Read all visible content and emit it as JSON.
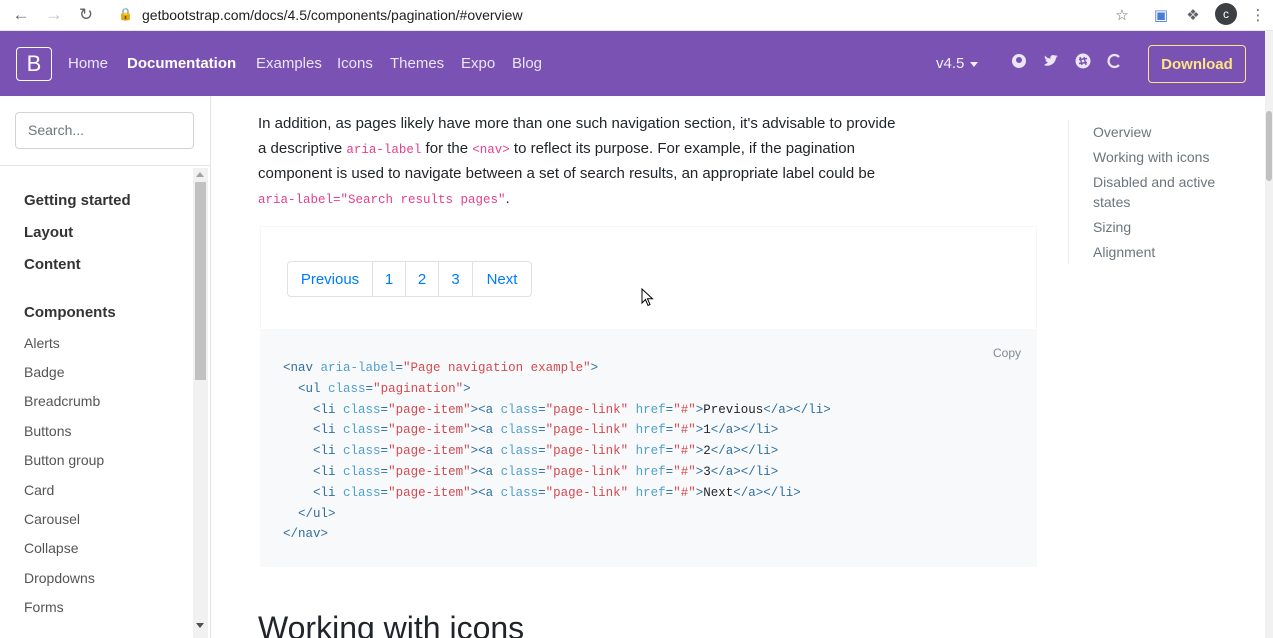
{
  "browser": {
    "url": "getbootstrap.com/docs/4.5/components/pagination/#overview",
    "avatar_letter": "c",
    "icons": [
      "back-icon",
      "forward-icon",
      "reload-icon",
      "lock-icon",
      "star-icon",
      "translate-icon",
      "extensions-icon",
      "menu-dots-icon"
    ]
  },
  "navbar": {
    "brand": "B",
    "links": [
      "Home",
      "Documentation",
      "Examples",
      "Icons",
      "Themes",
      "Expo",
      "Blog"
    ],
    "active": "Documentation",
    "version": "v4.5",
    "download": "Download",
    "accent": "#7952b3"
  },
  "sidebar": {
    "search_placeholder": "Search...",
    "groups": [
      "Getting started",
      "Layout",
      "Content",
      "Components"
    ],
    "items": [
      "Alerts",
      "Badge",
      "Breadcrumb",
      "Buttons",
      "Button group",
      "Card",
      "Carousel",
      "Collapse",
      "Dropdowns",
      "Forms"
    ]
  },
  "content": {
    "para_1": "In addition, as pages likely have more than one such navigation section, it's advisable to provide a descriptive ",
    "code_1": "aria-label",
    "para_2": " for the ",
    "code_2": "<nav>",
    "para_3": " to reflect its purpose. For example, if the pagination component is used to navigate between a set of search results, an appropriate label could be ",
    "code_3": "aria-label=\"Search results pages\"",
    "para_4": ".",
    "pagination": [
      "Previous",
      "1",
      "2",
      "3",
      "Next"
    ],
    "copy": "Copy",
    "code_lines": [
      {
        "indent": "",
        "parts": [
          [
            "tag",
            "<nav "
          ],
          [
            "attr",
            "aria-label"
          ],
          [
            "tag",
            "="
          ],
          [
            "val",
            "\"Page navigation example\""
          ],
          [
            "tag",
            ">"
          ]
        ]
      },
      {
        "indent": "  ",
        "parts": [
          [
            "tag",
            "<ul "
          ],
          [
            "attr",
            "class"
          ],
          [
            "tag",
            "="
          ],
          [
            "val",
            "\"pagination\""
          ],
          [
            "tag",
            ">"
          ]
        ]
      },
      {
        "indent": "    ",
        "parts": [
          [
            "tag",
            "<li "
          ],
          [
            "attr",
            "class"
          ],
          [
            "tag",
            "="
          ],
          [
            "val",
            "\"page-item\""
          ],
          [
            "tag",
            "><a "
          ],
          [
            "attr",
            "class"
          ],
          [
            "tag",
            "="
          ],
          [
            "val",
            "\"page-link\""
          ],
          [
            "tag",
            " "
          ],
          [
            "attr",
            "href"
          ],
          [
            "tag",
            "="
          ],
          [
            "val",
            "\"#\""
          ],
          [
            "tag",
            ">"
          ],
          [
            "text",
            "Previous"
          ],
          [
            "tag",
            "</a></li>"
          ]
        ]
      },
      {
        "indent": "    ",
        "parts": [
          [
            "tag",
            "<li "
          ],
          [
            "attr",
            "class"
          ],
          [
            "tag",
            "="
          ],
          [
            "val",
            "\"page-item\""
          ],
          [
            "tag",
            "><a "
          ],
          [
            "attr",
            "class"
          ],
          [
            "tag",
            "="
          ],
          [
            "val",
            "\"page-link\""
          ],
          [
            "tag",
            " "
          ],
          [
            "attr",
            "href"
          ],
          [
            "tag",
            "="
          ],
          [
            "val",
            "\"#\""
          ],
          [
            "tag",
            ">"
          ],
          [
            "text",
            "1"
          ],
          [
            "tag",
            "</a></li>"
          ]
        ]
      },
      {
        "indent": "    ",
        "parts": [
          [
            "tag",
            "<li "
          ],
          [
            "attr",
            "class"
          ],
          [
            "tag",
            "="
          ],
          [
            "val",
            "\"page-item\""
          ],
          [
            "tag",
            "><a "
          ],
          [
            "attr",
            "class"
          ],
          [
            "tag",
            "="
          ],
          [
            "val",
            "\"page-link\""
          ],
          [
            "tag",
            " "
          ],
          [
            "attr",
            "href"
          ],
          [
            "tag",
            "="
          ],
          [
            "val",
            "\"#\""
          ],
          [
            "tag",
            ">"
          ],
          [
            "text",
            "2"
          ],
          [
            "tag",
            "</a></li>"
          ]
        ]
      },
      {
        "indent": "    ",
        "parts": [
          [
            "tag",
            "<li "
          ],
          [
            "attr",
            "class"
          ],
          [
            "tag",
            "="
          ],
          [
            "val",
            "\"page-item\""
          ],
          [
            "tag",
            "><a "
          ],
          [
            "attr",
            "class"
          ],
          [
            "tag",
            "="
          ],
          [
            "val",
            "\"page-link\""
          ],
          [
            "tag",
            " "
          ],
          [
            "attr",
            "href"
          ],
          [
            "tag",
            "="
          ],
          [
            "val",
            "\"#\""
          ],
          [
            "tag",
            ">"
          ],
          [
            "text",
            "3"
          ],
          [
            "tag",
            "</a></li>"
          ]
        ]
      },
      {
        "indent": "    ",
        "parts": [
          [
            "tag",
            "<li "
          ],
          [
            "attr",
            "class"
          ],
          [
            "tag",
            "="
          ],
          [
            "val",
            "\"page-item\""
          ],
          [
            "tag",
            "><a "
          ],
          [
            "attr",
            "class"
          ],
          [
            "tag",
            "="
          ],
          [
            "val",
            "\"page-link\""
          ],
          [
            "tag",
            " "
          ],
          [
            "attr",
            "href"
          ],
          [
            "tag",
            "="
          ],
          [
            "val",
            "\"#\""
          ],
          [
            "tag",
            ">"
          ],
          [
            "text",
            "Next"
          ],
          [
            "tag",
            "</a></li>"
          ]
        ]
      },
      {
        "indent": "  ",
        "parts": [
          [
            "tag",
            "</ul>"
          ]
        ]
      },
      {
        "indent": "",
        "parts": [
          [
            "tag",
            "</nav>"
          ]
        ]
      }
    ],
    "next_heading": "Working with icons"
  },
  "toc": {
    "items": [
      "Overview",
      "Working with icons",
      "Disabled and active states",
      "Sizing",
      "Alignment"
    ]
  }
}
